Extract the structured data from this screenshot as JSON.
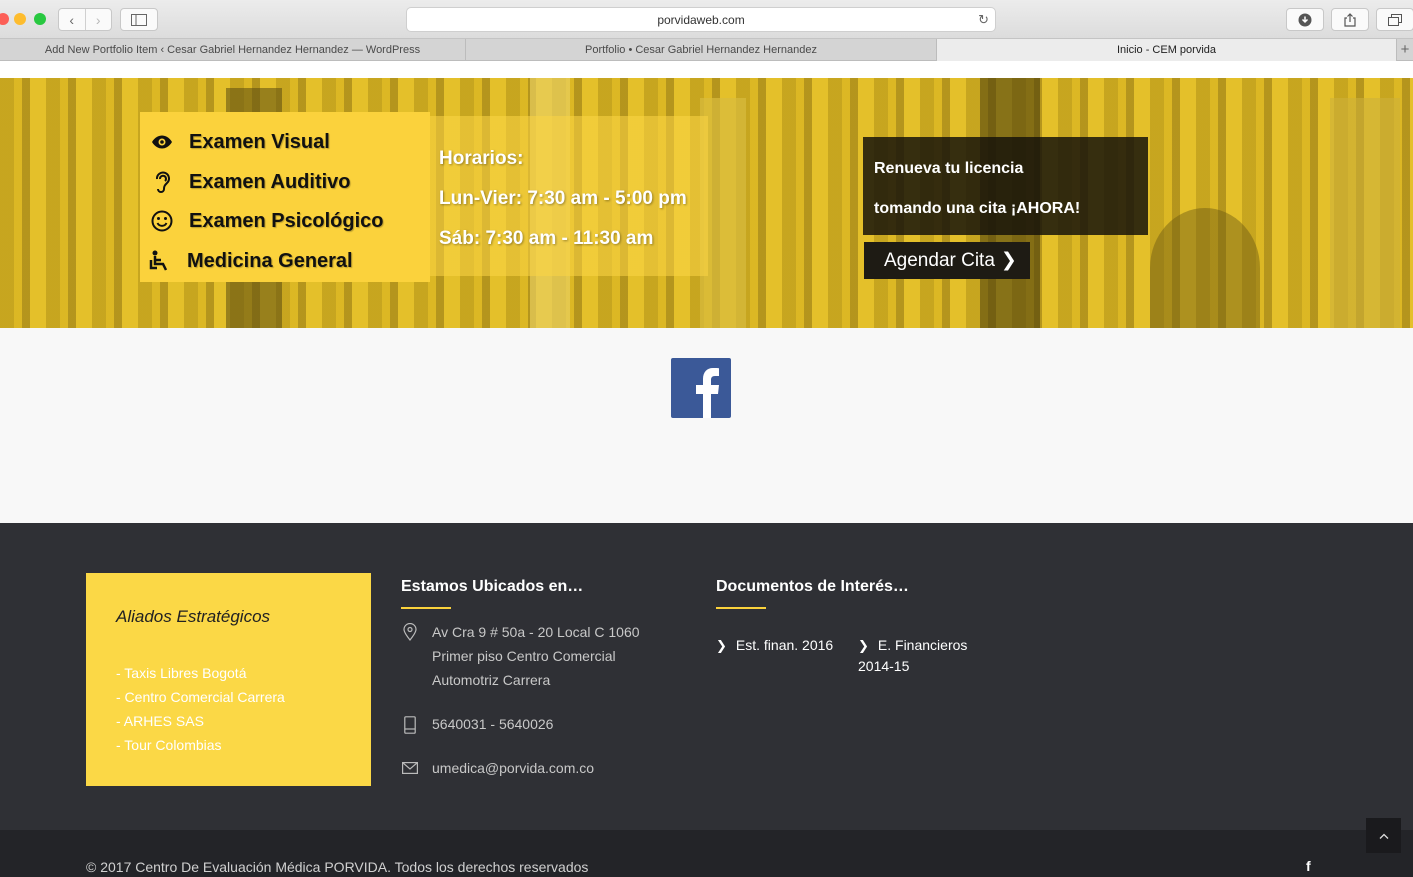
{
  "browser": {
    "url": "porvidaweb.com",
    "tabs": [
      {
        "title": "Add New Portfolio Item ‹ Cesar Gabriel Hernandez Hernandez — WordPress"
      },
      {
        "title": "Portfolio • Cesar Gabriel Hernandez Hernandez"
      },
      {
        "title": "Inicio - CEM porvida"
      }
    ]
  },
  "hero": {
    "services": [
      {
        "icon": "eye-icon",
        "label": "Examen Visual"
      },
      {
        "icon": "ear-icon",
        "label": "Examen Auditivo"
      },
      {
        "icon": "smiley-icon",
        "label": "Examen Psicológico"
      },
      {
        "icon": "wheelchair-icon",
        "label": "Medicina General"
      }
    ],
    "hours_title": "Horarios:",
    "hours_weekdays": "Lun-Vier: 7:30 am - 5:00 pm",
    "hours_saturday": "Sáb: 7:30 am - 11:30 am",
    "license_line1": "Renueva tu licencia",
    "license_line2": "tomando una cita ¡AHORA!",
    "cta_label": "Agendar Cita"
  },
  "footer": {
    "allies_title": "Aliados Estratégicos",
    "allies": [
      "- Taxis Libres Bogotá",
      "- Centro Comercial Carrera",
      "- ARHES SAS",
      "- Tour Colombias"
    ],
    "location_title": "Estamos Ubicados en…",
    "address": [
      "Av Cra 9 # 50a - 20 Local C 1060",
      "Primer piso Centro Comercial",
      "Automotriz Carrera"
    ],
    "phone": "5640031 - 5640026",
    "email": "umedica@porvida.com.co",
    "docs_title": "Documentos de Interés…",
    "docs": [
      {
        "line1": "Est. finan. 2016",
        "line2": ""
      },
      {
        "line1": "E. Financieros",
        "line2": "2014-15"
      }
    ],
    "copyright": "© 2017 Centro De Evaluación Médica PORVIDA. Todos los derechos reservados"
  }
}
